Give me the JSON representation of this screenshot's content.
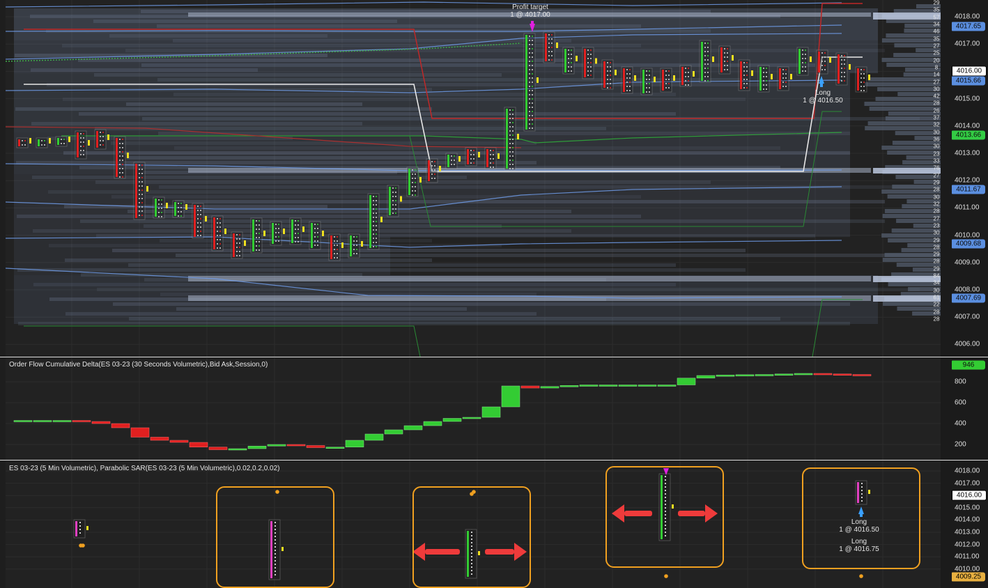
{
  "panels": {
    "price": {
      "axis_ticks": [
        "4018.00",
        "4017.00",
        "4016.00",
        "4015.00",
        "4014.00",
        "4013.00",
        "4012.00",
        "4011.00",
        "4010.00",
        "4009.00",
        "4008.00",
        "4007.00",
        "4006.00"
      ],
      "price_tags": [
        {
          "value": "4017.65",
          "kind": "blue"
        },
        {
          "value": "4016.00",
          "kind": "current"
        },
        {
          "value": "4015.66",
          "kind": "blue"
        },
        {
          "value": "4013.66",
          "kind": "green"
        },
        {
          "value": "4011.67",
          "kind": "blue"
        },
        {
          "value": "4009.68",
          "kind": "blue"
        },
        {
          "value": "4007.69",
          "kind": "blue"
        }
      ],
      "volume_labels": [
        "29",
        "35",
        "57",
        "34",
        "46",
        "35",
        "27",
        "25",
        "20",
        "8",
        "14",
        "27",
        "30",
        "42",
        "28",
        "26",
        "37",
        "32",
        "30",
        "36",
        "30",
        "23",
        "33",
        "76",
        "27",
        "29",
        "28",
        "30",
        "32",
        "28",
        "27",
        "23",
        "30",
        "29",
        "28",
        "29",
        "28",
        "29",
        "84",
        "34",
        "30",
        "61",
        "22",
        "28",
        "28"
      ],
      "annotations": {
        "profit_target_title": "Profit target",
        "profit_target_detail": "1 @ 4017.00",
        "long_title": "Long",
        "long_detail": "1 @ 4016.50"
      }
    },
    "delta": {
      "title": "Order Flow Cumulative Delta(ES 03-23 (30 Seconds Volumetric),Bid Ask,Session,0)",
      "axis_ticks": [
        "800",
        "600",
        "400",
        "200"
      ],
      "current_tag": "946"
    },
    "sar": {
      "title": "ES 03-23 (5 Min Volumetric), Parabolic SAR(ES 03-23 (5 Min Volumetric),0.02,0.2,0.02)",
      "axis_ticks": [
        "4018.00",
        "4017.00",
        "4015.00",
        "4014.00",
        "4013.00",
        "4012.00",
        "4011.00",
        "4010.00"
      ],
      "current_tag": "4016.00",
      "sar_tag": "4009.25",
      "long_title_1": "Long",
      "long_detail_1": "1 @ 4016.50",
      "long_title_2": "Long",
      "long_detail_2": "1 @ 4016.75"
    }
  },
  "colors": {
    "background": "#222222",
    "up_candle": "#33cc33",
    "down_candle": "#e02020",
    "vwap_band": "#6f9be8",
    "highlight": "#f0a020",
    "current_price_tag": "#ffffff",
    "sar_tag": "#e8b040",
    "green_tag": "#33cc44",
    "blue_tag": "#5b8fe0"
  }
}
